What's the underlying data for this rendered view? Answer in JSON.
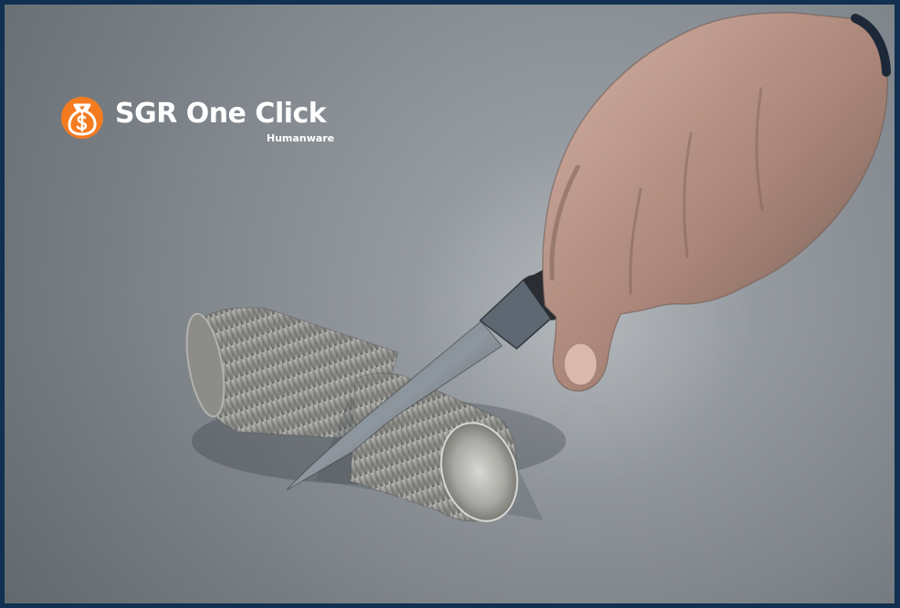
{
  "brand": {
    "name": "SGR One Click",
    "subtitle": "Humanware",
    "icon": "money-bag-icon",
    "accent_color": "#f47b20"
  },
  "hero_image": {
    "subject": "hand-cutting-coin-stack"
  }
}
